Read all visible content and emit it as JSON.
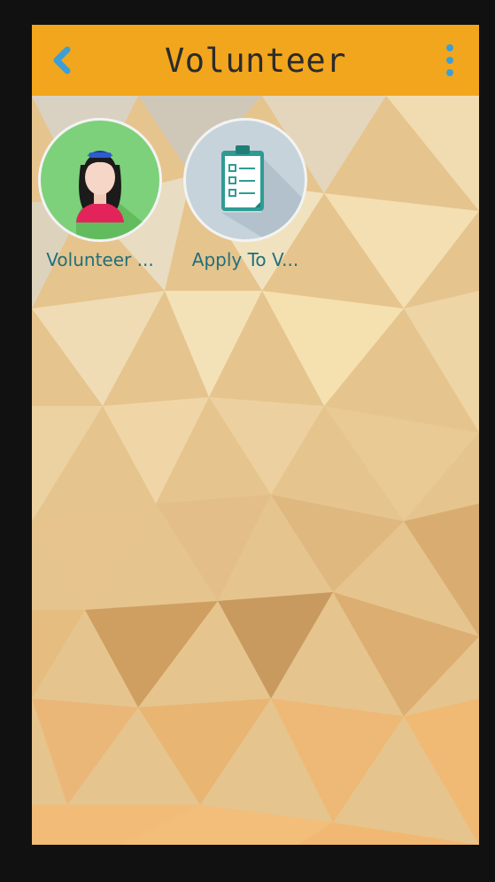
{
  "app_bar": {
    "title": "Volunteer",
    "back_icon": "chevron-left-icon",
    "menu_icon": "more-vert-icon",
    "background_color": "#f2a61d",
    "icon_color": "#3d9fd6"
  },
  "tiles": [
    {
      "label": "Volunteer ...",
      "icon": "volunteer-person-icon",
      "circle_color": "#7dd17a"
    },
    {
      "label": "Apply To V...",
      "icon": "clipboard-checklist-icon",
      "circle_color": "#c7d3db"
    }
  ]
}
